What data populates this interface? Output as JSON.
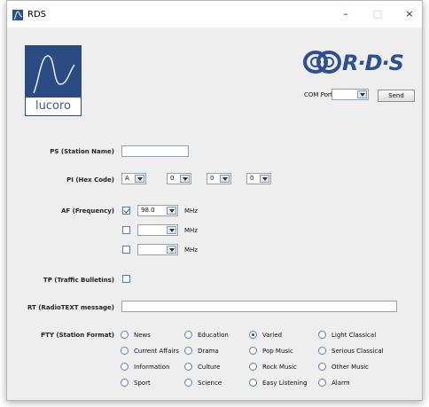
{
  "window": {
    "title": "RDS"
  },
  "titlebar": {
    "minimize": "–",
    "maximize": "□",
    "close": "×"
  },
  "logos": {
    "lucoro": "lucoro",
    "rds": "R·D·S"
  },
  "com": {
    "label": "COM Port",
    "value": "",
    "send_label": "Send"
  },
  "ps": {
    "label": "PS (Station Name)",
    "value": ""
  },
  "pi": {
    "label": "PI (Hex Code)",
    "digits": [
      "A",
      "0",
      "0",
      "0"
    ]
  },
  "af": {
    "label": "AF (Frequency)",
    "unit": "MHz",
    "rows": [
      {
        "checked": true,
        "value": "98.0"
      },
      {
        "checked": false,
        "value": ""
      },
      {
        "checked": false,
        "value": ""
      }
    ]
  },
  "tp": {
    "label": "TP (Traffic Bulletins)",
    "checked": false
  },
  "rt": {
    "label": "RT (RadioTEXT message)",
    "value": ""
  },
  "pty": {
    "label": "PTY (Station Format)",
    "selected": "Varied",
    "options": [
      [
        "News",
        "Education",
        "Varied",
        "Light Classical"
      ],
      [
        "Current Affairs",
        "Drama",
        "Pop Music",
        "Serious Classical"
      ],
      [
        "Information",
        "Culture",
        "Rock Music",
        "Other Music"
      ],
      [
        "Sport",
        "Science",
        "Easy Listening",
        "Alarm"
      ]
    ]
  },
  "colors": {
    "brand": "#2b4b83",
    "background": "#eeeeee",
    "accent": "#1d4f9f"
  }
}
